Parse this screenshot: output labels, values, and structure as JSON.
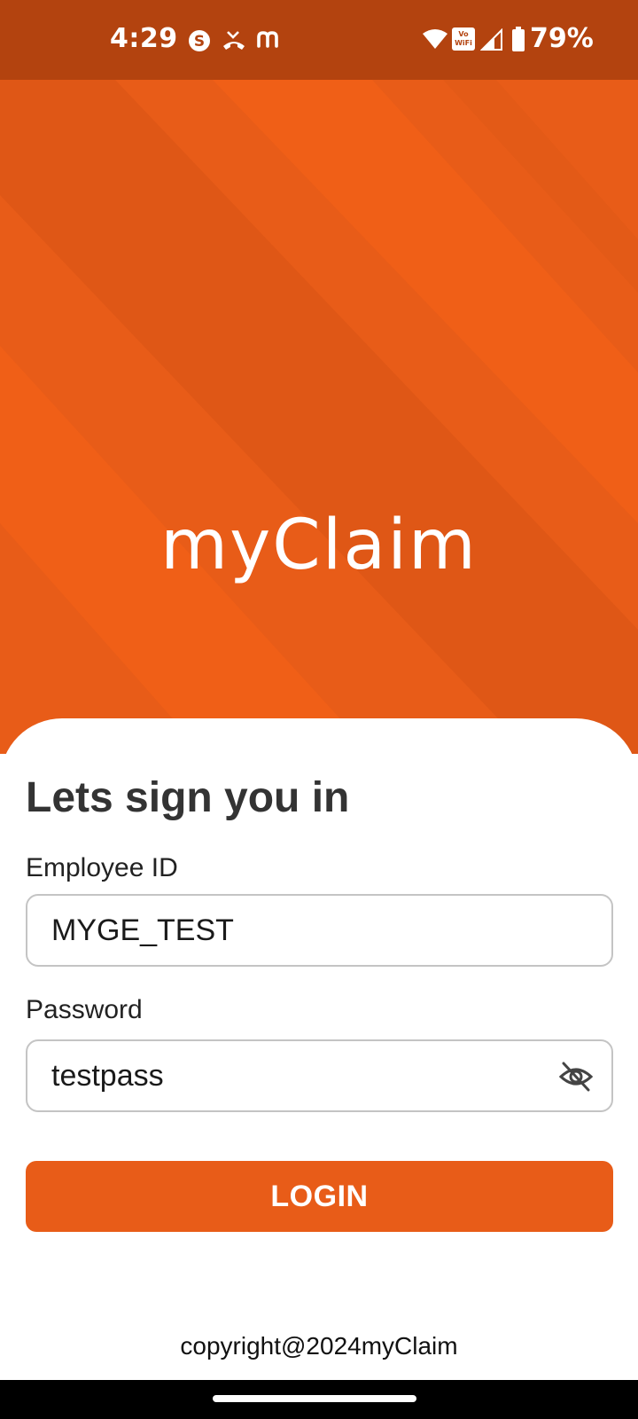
{
  "status_bar": {
    "time": "4:29",
    "battery": "79%",
    "vowifi_label_top": "Vo",
    "vowifi_label_bottom": "WiFi",
    "icons": [
      "skype-icon",
      "missed-call-icon",
      "m-icon",
      "wifi-icon",
      "vowifi-icon",
      "signal-icon",
      "battery-icon"
    ]
  },
  "hero": {
    "logo": "myClaim",
    "color": "#e85c18"
  },
  "login": {
    "heading": "Lets sign you in",
    "employee_id_label": "Employee ID",
    "employee_id_value": "MYGE_TEST",
    "password_label": "Password",
    "password_value": "testpass",
    "password_toggle_icon": "eye-off-icon",
    "login_button": "LOGIN",
    "button_color": "#e85c18"
  },
  "footer": {
    "copyright": "copyright@2024myClaim"
  }
}
